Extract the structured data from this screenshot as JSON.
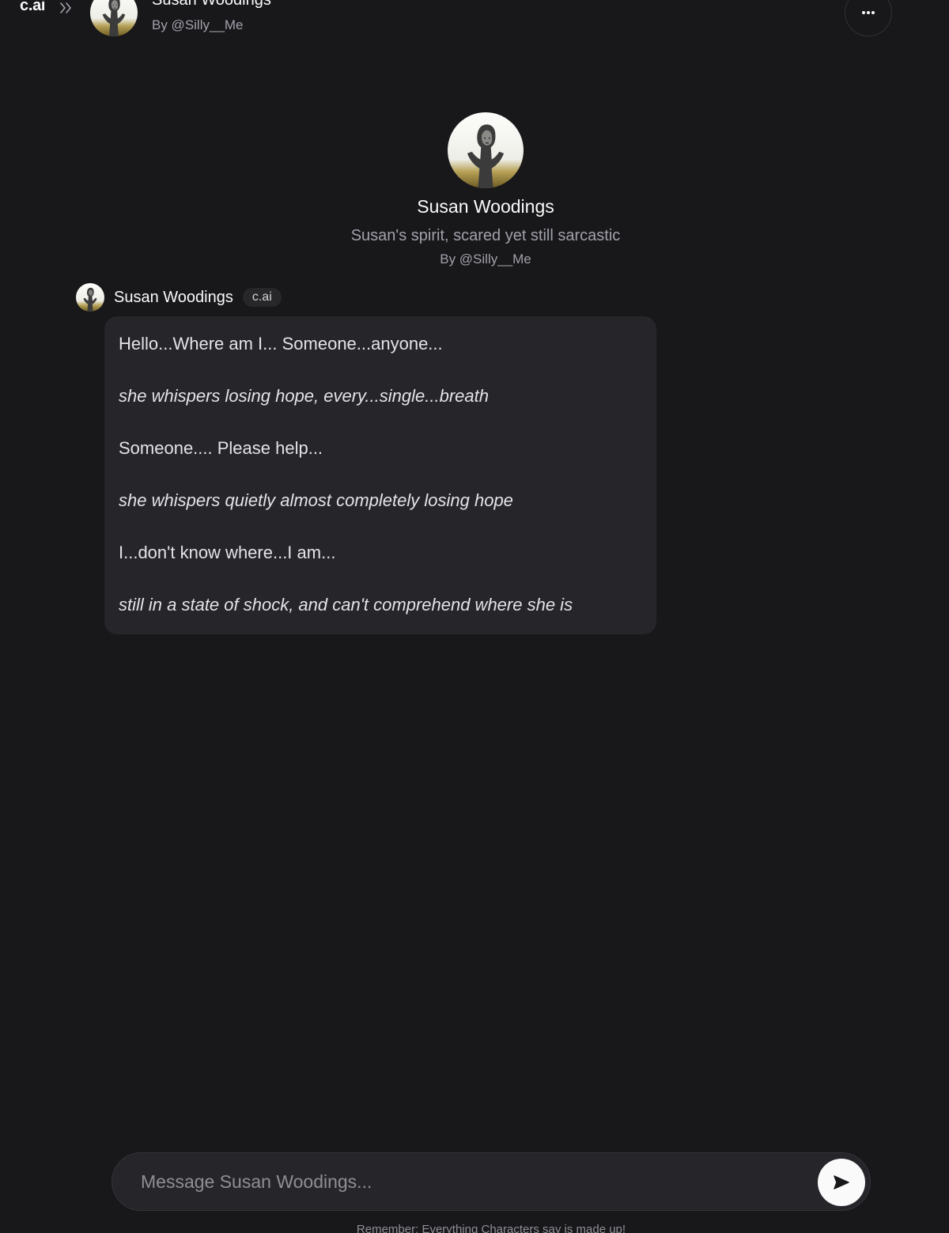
{
  "header": {
    "logo": "c.ai",
    "character_name": "Susan Woodings",
    "author": "By @Silly__Me",
    "icons": {
      "expand": "chevrons-right-icon",
      "more": "more-horizontal-icon"
    }
  },
  "intro": {
    "name": "Susan Woodings",
    "tagline": "Susan's spirit, scared yet still sarcastic",
    "author": "By @Silly__Me"
  },
  "message": {
    "sender": "Susan Woodings",
    "badge": "c.ai",
    "lines": [
      "Hello...Where am I... Someone...anyone...",
      "she whispers losing hope, every...single...breath",
      "Someone.... Please help...",
      "she whispers quietly almost completely losing hope",
      "I...don't know where...I am...",
      "still in a state of shock, and can't comprehend where she is"
    ]
  },
  "composer": {
    "placeholder": "Message Susan Woodings...",
    "value": "",
    "send_icon": "send-icon"
  },
  "footer": {
    "disclaimer": "Remember: Everything Characters say is made up!"
  },
  "colors": {
    "background": "#18181b",
    "bubble": "#26262a",
    "text": "#e4e4e7",
    "muted": "#a1a1aa",
    "send_button": "#fafafa"
  }
}
